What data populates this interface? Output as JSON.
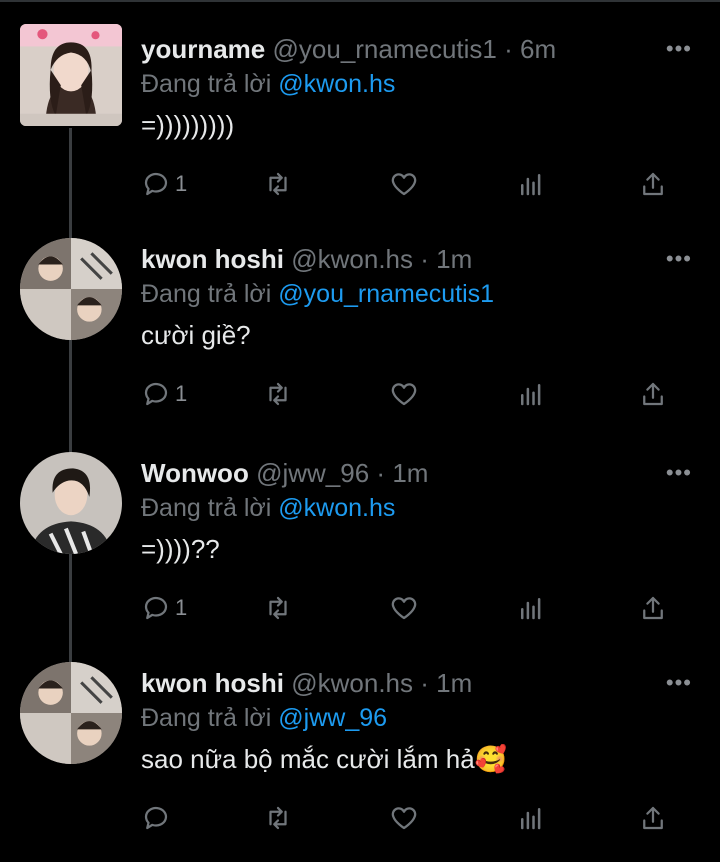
{
  "reply_prefix": "Đang trả lời",
  "tweets": [
    {
      "name": "yourname",
      "handle": "@you_rnamecutis1",
      "separator": "·",
      "time": "6m",
      "reply_to": "@kwon.hs",
      "text": "=)))))))))",
      "reply_count": "1",
      "avatar": "girl-portrait"
    },
    {
      "name": "kwon hoshi",
      "handle": "@kwon.hs",
      "separator": "·",
      "time": "1m",
      "reply_to": "@you_rnamecutis1",
      "text": "cười giề?",
      "reply_count": "1",
      "avatar": "photo-collage"
    },
    {
      "name": "Wonwoo",
      "handle": "@jww_96",
      "separator": "·",
      "time": "1m",
      "reply_to": "@kwon.hs",
      "text": "=))))??",
      "reply_count": "1",
      "avatar": "man-portrait"
    },
    {
      "name": "kwon hoshi",
      "handle": "@kwon.hs",
      "separator": "·",
      "time": "1m",
      "reply_to": "@jww_96",
      "text": "sao nữa bộ mắc cười lắm hả🥰",
      "reply_count": "",
      "avatar": "photo-collage"
    }
  ],
  "icons": {
    "reply": "reply-icon",
    "retweet": "retweet-icon",
    "like": "heart-icon",
    "views": "views-icon",
    "share": "share-icon",
    "more": "more-icon"
  },
  "colors": {
    "background": "#000000",
    "text": "#e7e9ea",
    "secondary": "#71767b",
    "link": "#1d9bf0",
    "thread_line": "#3a3d40"
  }
}
